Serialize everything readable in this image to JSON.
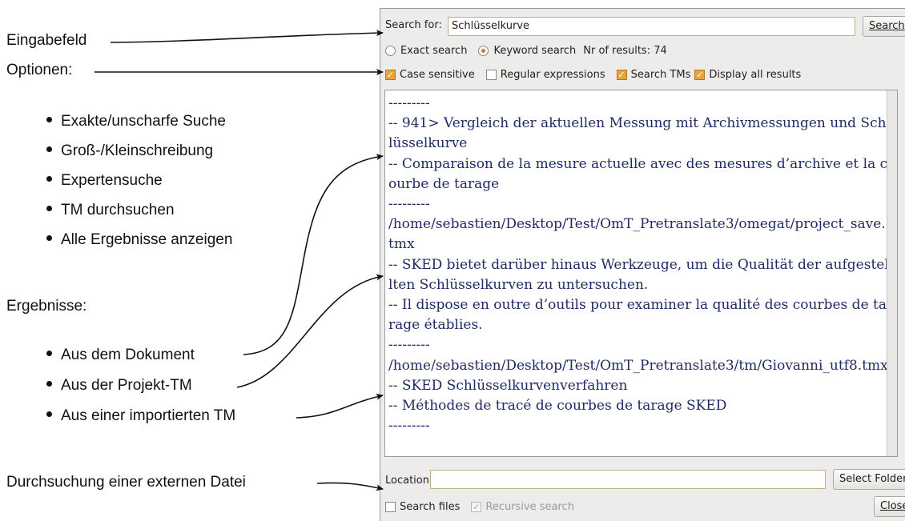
{
  "annotations": {
    "input_field": "Eingabefeld",
    "options": "Optionen:",
    "option_items": [
      "Exakte/unscharfe Suche",
      "Groß-/Kleinschreibung",
      "Expertensuche",
      "TM durchsuchen",
      "Alle Ergebnisse anzeigen"
    ],
    "results": "Ergebnisse:",
    "result_items": [
      "Aus dem Dokument",
      "Aus der Projekt-TM",
      "Aus einer importierten TM"
    ],
    "external": "Durchsuchung einer externen Datei"
  },
  "search": {
    "label": "Search for:",
    "value": "Schlüsselkurve",
    "button": "Search"
  },
  "mode": {
    "exact": "Exact search",
    "keyword": "Keyword search",
    "selected": "keyword",
    "results_count": "Nr of results: 74"
  },
  "options": {
    "case_sensitive": {
      "label": "Case sensitive",
      "checked": true
    },
    "regex": {
      "label": "Regular expressions",
      "checked": false
    },
    "search_tms": {
      "label": "Search TMs",
      "checked": true
    },
    "display_all": {
      "label": "Display all results",
      "checked": true
    }
  },
  "results_lines": [
    "---------",
    "-- 941> Vergleich der aktuellen Messung mit Archivmessungen und Schlüsselkurve",
    "-- Comparaison de la mesure actuelle avec des mesures d’archive et la courbe de tarage",
    "---------",
    "/home/sebastien/Desktop/Test/OmT_Pretranslate3/omegat/project_save.tmx",
    "-- SKED bietet darüber hinaus Werkzeuge, um die Qualität der aufgestellten Schlüsselkurven zu untersuchen.",
    "-- Il dispose en outre d’outils pour examiner la qualité des courbes de tarage établies.",
    "---------",
    "/home/sebastien/Desktop/Test/OmT_Pretranslate3/tm/Giovanni_utf8.tmx",
    "-- SKED Schlüsselkurvenverfahren",
    "-- Méthodes de tracé de courbes de tarage SKED",
    "---------"
  ],
  "location": {
    "label": "Location",
    "value": "",
    "select_button": "Select Folder"
  },
  "bottom": {
    "search_files": {
      "label": "Search files",
      "checked": false
    },
    "recursive": {
      "label": "Recursive search",
      "checked": true,
      "disabled": true
    },
    "close": "Close"
  },
  "colors": {
    "result_text": "#1f2a66",
    "dialog_bg": "#edeceb",
    "check_accent": "#e8a33a"
  }
}
